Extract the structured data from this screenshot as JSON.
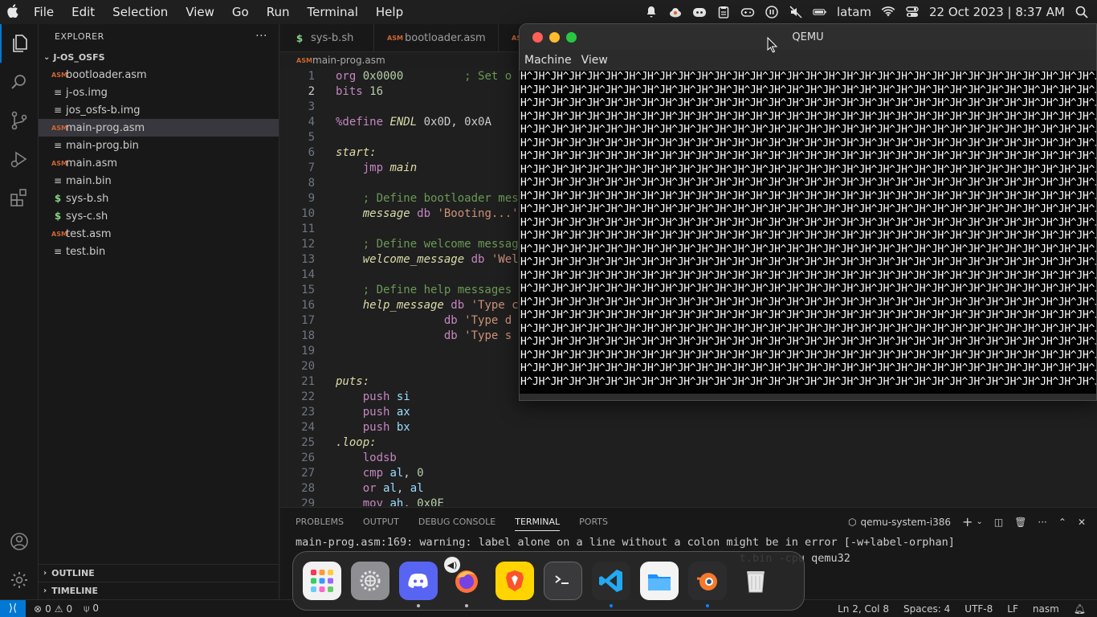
{
  "menubar": {
    "apple": "",
    "items": [
      "File",
      "Edit",
      "Selection",
      "View",
      "Go",
      "Run",
      "Terminal",
      "Help"
    ],
    "input_source": "latam",
    "datetime": "22 Oct 2023 | 8:37 AM"
  },
  "explorer": {
    "title": "EXPLORER",
    "more": "···",
    "folder": "J-OS_OSFS",
    "files": [
      {
        "name": "bootloader.asm",
        "type": "asm"
      },
      {
        "name": "j-os.img",
        "type": "txt"
      },
      {
        "name": "jos_osfs-b.img",
        "type": "txt"
      },
      {
        "name": "main-prog.asm",
        "type": "asm",
        "selected": true
      },
      {
        "name": "main-prog.bin",
        "type": "txt"
      },
      {
        "name": "main.asm",
        "type": "asm"
      },
      {
        "name": "main.bin",
        "type": "txt"
      },
      {
        "name": "sys-b.sh",
        "type": "sh"
      },
      {
        "name": "sys-c.sh",
        "type": "sh"
      },
      {
        "name": "test.asm",
        "type": "asm"
      },
      {
        "name": "test.bin",
        "type": "txt"
      }
    ],
    "outline": "OUTLINE",
    "timeline": "TIMELINE"
  },
  "tabs": [
    {
      "label": "sys-b.sh",
      "type": "sh"
    },
    {
      "label": "bootloader.asm",
      "type": "asm"
    }
  ],
  "breadcrumb": "main-prog.asm",
  "code_lines": [
    {
      "n": "1",
      "html": [
        [
          "kw",
          "org "
        ],
        [
          "num",
          "0x0000"
        ],
        [
          "",
          "         "
        ],
        [
          "cmt",
          "; Set o"
        ]
      ]
    },
    {
      "n": "2",
      "html": [
        [
          "kw",
          "bits "
        ],
        [
          "num",
          "16"
        ]
      ],
      "current": true
    },
    {
      "n": "3",
      "html": []
    },
    {
      "n": "4",
      "html": [
        [
          "kw",
          "%define "
        ],
        [
          "lbl",
          "ENDL "
        ],
        [
          "",
          "0x0D, 0x0A"
        ]
      ]
    },
    {
      "n": "5",
      "html": []
    },
    {
      "n": "6",
      "html": [
        [
          "lbl",
          "start:"
        ]
      ]
    },
    {
      "n": "7",
      "html": [
        [
          "",
          "    "
        ],
        [
          "kw",
          "jmp "
        ],
        [
          "lbl",
          "main"
        ]
      ]
    },
    {
      "n": "8",
      "html": []
    },
    {
      "n": "9",
      "html": [
        [
          "",
          "    "
        ],
        [
          "cmt",
          "; Define bootloader mes"
        ]
      ]
    },
    {
      "n": "10",
      "html": [
        [
          "",
          "    "
        ],
        [
          "lbl",
          "message "
        ],
        [
          "kw",
          "db "
        ],
        [
          "str",
          "'Booting...'"
        ]
      ]
    },
    {
      "n": "11",
      "html": []
    },
    {
      "n": "12",
      "html": [
        [
          "",
          "    "
        ],
        [
          "cmt",
          "; Define welcome messag"
        ]
      ]
    },
    {
      "n": "13",
      "html": [
        [
          "",
          "    "
        ],
        [
          "lbl",
          "welcome_message "
        ],
        [
          "kw",
          "db "
        ],
        [
          "str",
          "'Wel"
        ]
      ]
    },
    {
      "n": "14",
      "html": []
    },
    {
      "n": "15",
      "html": [
        [
          "",
          "    "
        ],
        [
          "cmt",
          "; Define help messages"
        ]
      ]
    },
    {
      "n": "16",
      "html": [
        [
          "",
          "    "
        ],
        [
          "lbl",
          "help_message "
        ],
        [
          "kw",
          "db "
        ],
        [
          "str",
          "'Type c"
        ]
      ]
    },
    {
      "n": "17",
      "html": [
        [
          "",
          "                "
        ],
        [
          "kw",
          "db "
        ],
        [
          "str",
          "'Type d"
        ]
      ]
    },
    {
      "n": "18",
      "html": [
        [
          "",
          "                "
        ],
        [
          "kw",
          "db "
        ],
        [
          "str",
          "'Type s"
        ]
      ]
    },
    {
      "n": "19",
      "html": []
    },
    {
      "n": "20",
      "html": []
    },
    {
      "n": "21",
      "html": [
        [
          "lbl",
          "puts:"
        ]
      ]
    },
    {
      "n": "22",
      "html": [
        [
          "",
          "    "
        ],
        [
          "kw",
          "push "
        ],
        [
          "reg",
          "si"
        ]
      ]
    },
    {
      "n": "23",
      "html": [
        [
          "",
          "    "
        ],
        [
          "kw",
          "push "
        ],
        [
          "reg",
          "ax"
        ]
      ]
    },
    {
      "n": "24",
      "html": [
        [
          "",
          "    "
        ],
        [
          "kw",
          "push "
        ],
        [
          "reg",
          "bx"
        ]
      ]
    },
    {
      "n": "25",
      "html": [
        [
          "lbl",
          ".loop:"
        ]
      ]
    },
    {
      "n": "26",
      "html": [
        [
          "",
          "    "
        ],
        [
          "kw",
          "lodsb"
        ]
      ]
    },
    {
      "n": "27",
      "html": [
        [
          "",
          "    "
        ],
        [
          "kw",
          "cmp "
        ],
        [
          "reg",
          "al"
        ],
        [
          "",
          ", "
        ],
        [
          "num",
          "0"
        ]
      ]
    },
    {
      "n": "28",
      "html": [
        [
          "",
          "    "
        ],
        [
          "kw",
          "or "
        ],
        [
          "reg",
          "al"
        ],
        [
          "",
          ", "
        ],
        [
          "reg",
          "al"
        ]
      ]
    },
    {
      "n": "29",
      "html": [
        [
          "",
          "    "
        ],
        [
          "kw",
          "mov "
        ],
        [
          "reg",
          "ah"
        ],
        [
          "",
          ", "
        ],
        [
          "num",
          "0x0E"
        ]
      ]
    }
  ],
  "panel": {
    "tabs": [
      "PROBLEMS",
      "OUTPUT",
      "DEBUG CONSOLE",
      "TERMINAL",
      "PORTS"
    ],
    "active_tab": "TERMINAL",
    "terminal_name": "qemu-system-i386",
    "lines": [
      "main-prog.asm:169: warning: label alone on a line without a colon might be in error [-w+label-orphan]",
      "                                                                    t.bin -cpu qemu32"
    ]
  },
  "statusbar": {
    "errors": "0",
    "warnings": "0",
    "ports": "0",
    "position": "Ln 2, Col 8",
    "spaces": "Spaces: 4",
    "encoding": "UTF-8",
    "eol": "LF",
    "language": "nasm"
  },
  "qemu": {
    "title": "QEMU",
    "menu": [
      "Machine",
      "View"
    ],
    "screen_glyphs": "H^J",
    "rows": 24
  },
  "dock": {
    "apps": [
      "launchpad-icon",
      "settings-icon",
      "discord-icon",
      "firefox-icon",
      "brave-icon",
      "terminal-icon",
      "vscode-icon",
      "files-icon",
      "blender-icon",
      "trash-icon"
    ]
  },
  "colors": {
    "accent": "#0078d4",
    "editor_bg": "#1f1f1f",
    "sidebar_bg": "#181818"
  }
}
